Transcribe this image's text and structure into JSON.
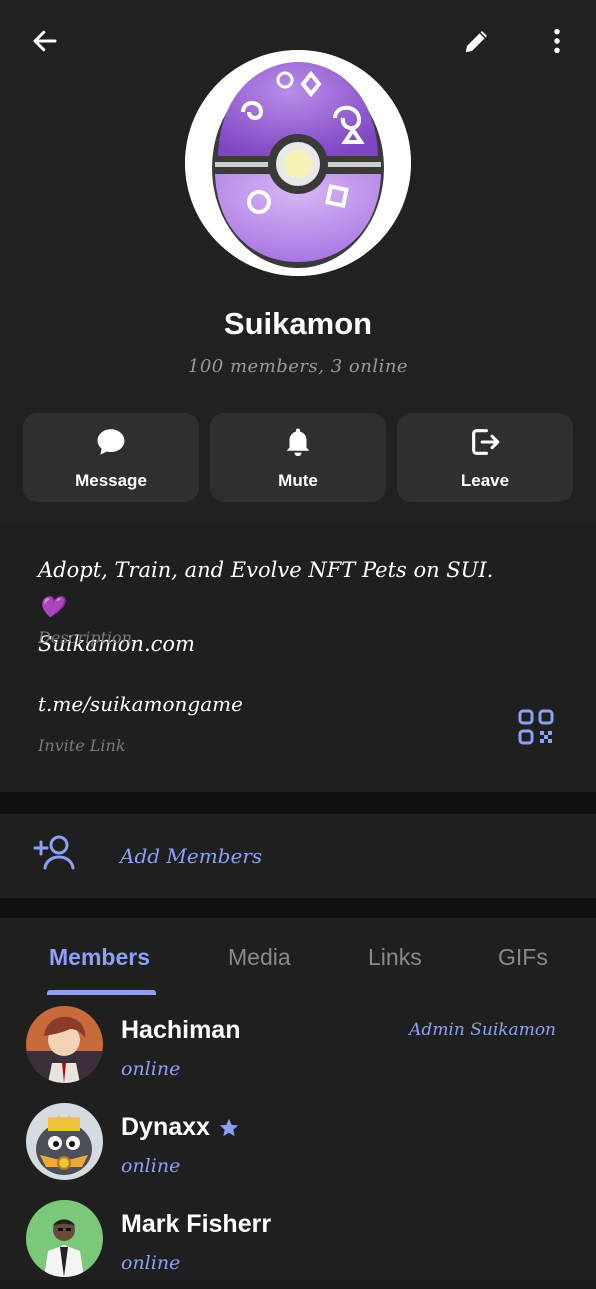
{
  "header": {
    "back_icon": "arrow-left-icon",
    "edit_icon": "pencil-icon",
    "more_icon": "dots-vertical-icon"
  },
  "group": {
    "name": "Suikamon",
    "subtitle": "100 members, 3 online"
  },
  "actions": [
    {
      "label": "Message",
      "icon": "chat-bubble-icon"
    },
    {
      "label": "Mute",
      "icon": "bell-icon"
    },
    {
      "label": "Leave",
      "icon": "logout-icon"
    }
  ],
  "info": {
    "description_line1": "Adopt, Train, and Evolve NFT Pets on SUI.",
    "description_emoji": "💜",
    "description_line2": "Suikamon.com",
    "description_caption": "Description",
    "invite_link": "t.me/suikamongame",
    "invite_caption": "Invite Link"
  },
  "add_members": {
    "label": "Add Members",
    "icon": "add-user-icon"
  },
  "tabs": [
    {
      "label": "Members",
      "active": true
    },
    {
      "label": "Media",
      "active": false
    },
    {
      "label": "Links",
      "active": false
    },
    {
      "label": "GIFs",
      "active": false
    }
  ],
  "members": [
    {
      "name": "Hachiman",
      "status": "online",
      "role": "Admin Suikamon",
      "badge": ""
    },
    {
      "name": "Dynaxx",
      "status": "online",
      "role": "",
      "badge": "star-icon"
    },
    {
      "name": "Mark Fisherr",
      "status": "online",
      "role": "",
      "badge": ""
    }
  ],
  "colors": {
    "accent": "#8ea0f5",
    "background": "#1c1c1e",
    "card": "#2f2f31"
  }
}
